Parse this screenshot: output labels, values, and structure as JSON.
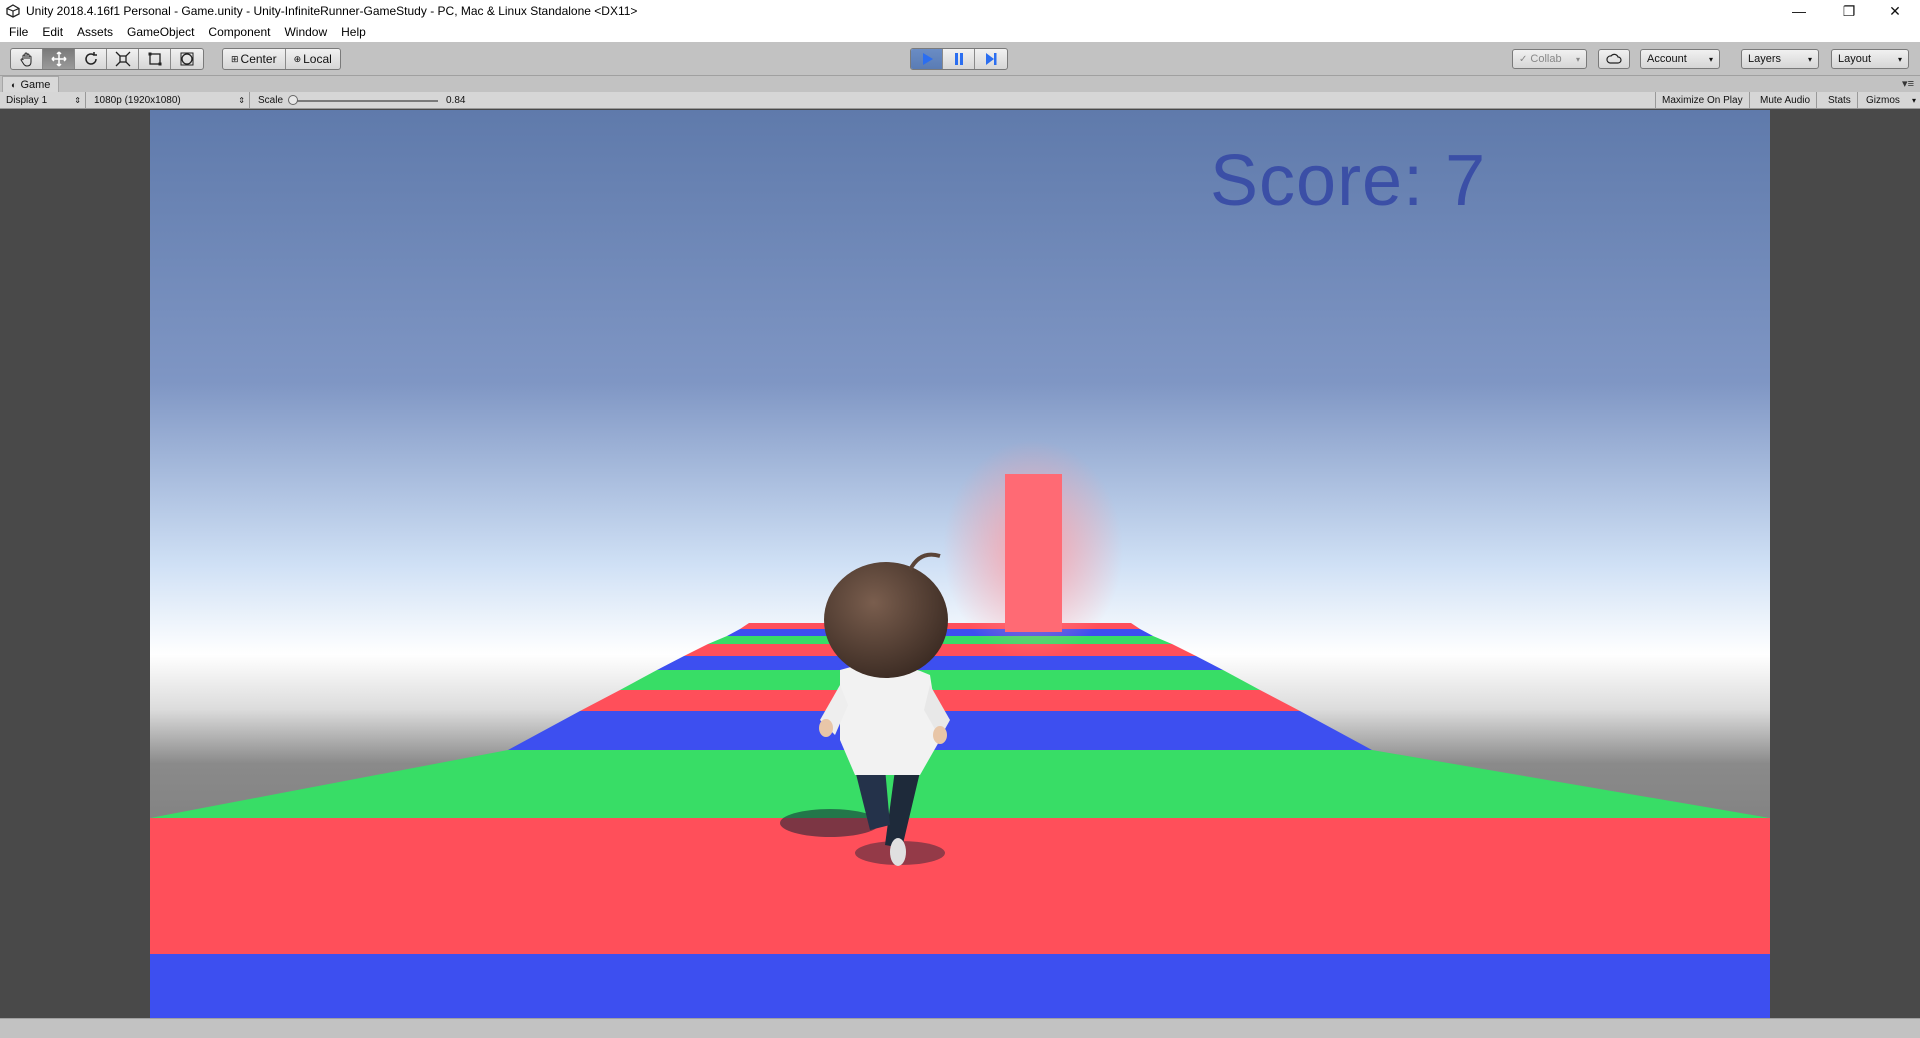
{
  "window": {
    "title": "Unity 2018.4.16f1 Personal - Game.unity - Unity-InfiniteRunner-GameStudy - PC, Mac & Linux Standalone <DX11>",
    "minimize_glyph": "—",
    "restore_glyph": "❐",
    "close_glyph": "✕"
  },
  "menu": [
    "File",
    "Edit",
    "Assets",
    "GameObject",
    "Component",
    "Window",
    "Help"
  ],
  "toolbar": {
    "tools": [
      "hand-icon",
      "move-icon",
      "rotate-icon",
      "scale-icon",
      "rect-icon",
      "transform-icon"
    ],
    "pivot_center": "Center",
    "pivot_local": "Local",
    "collab": "Collab",
    "account": "Account",
    "layers": "Layers",
    "layout": "Layout"
  },
  "game": {
    "tab_label": "Game",
    "display": "Display 1",
    "resolution": "1080p (1920x1080)",
    "scale_label": "Scale",
    "scale_value": "0.84",
    "maximize_on_play": "Maximize On Play",
    "mute_audio": "Mute Audio",
    "stats": "Stats",
    "gizmos": "Gizmos",
    "score_text": "Score: 7"
  },
  "colors": {
    "stripe_red": "#ff4f5a",
    "stripe_green": "#38dd66",
    "stripe_blue": "#3d4ff0",
    "score": "#3b4fa6"
  }
}
